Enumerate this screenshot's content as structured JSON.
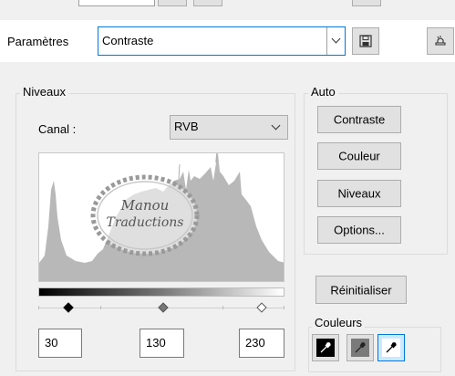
{
  "params": {
    "label": "Paramètres",
    "preset_value": "Contraste"
  },
  "levels": {
    "title": "Niveaux",
    "channel_label": "Canal :",
    "channel_value": "RVB",
    "input_black": "30",
    "input_gamma": "130",
    "input_white": "230"
  },
  "auto": {
    "title": "Auto",
    "contrast_label": "Contraste",
    "color_label": "Couleur",
    "levels_label": "Niveaux",
    "options_label": "Options..."
  },
  "reset_label": "Réinitialiser",
  "colors": {
    "title": "Couleurs",
    "accent": "#0078d7",
    "selected_bg": "#cce8ff"
  },
  "watermark": {
    "line1": "Manou",
    "line2": "Traductions"
  },
  "icons": {
    "save": "save-icon",
    "adjust": "adjust-icon",
    "black_point": "black-eyedropper-icon",
    "gray_point": "gray-eyedropper-icon",
    "white_point": "white-eyedropper-icon"
  }
}
